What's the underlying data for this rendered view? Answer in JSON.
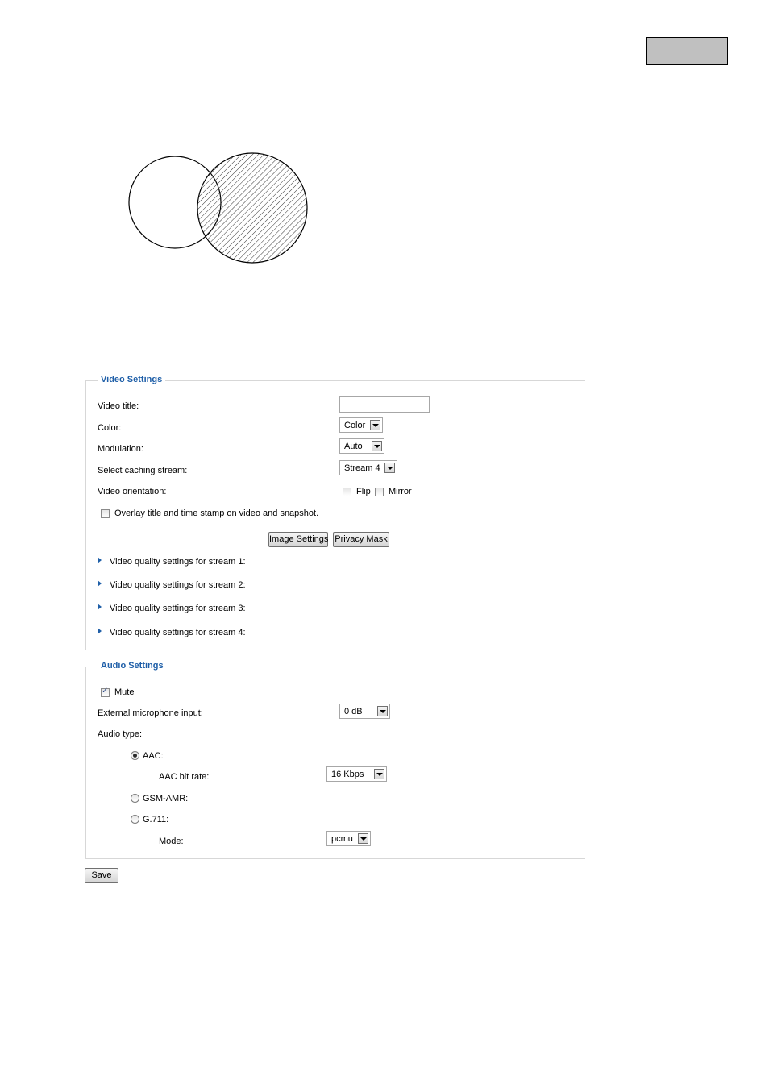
{
  "video": {
    "title": "Video Settings",
    "video_title_label": "Video title:",
    "video_title_value": "",
    "color_label": "Color:",
    "color_value": "Color",
    "modulation_label": "Modulation:",
    "modulation_value": "Auto",
    "caching_label": "Select caching stream:",
    "caching_value": "Stream 4",
    "orientation_label": "Video orientation:",
    "flip_label": "Flip",
    "mirror_label": "Mirror",
    "overlay_label": "Overlay title and time stamp on video and snapshot.",
    "image_settings_button": "Image Settings",
    "privacy_mask_button": "Privacy Mask",
    "streams": [
      "Video quality settings for stream 1:",
      "Video quality settings for stream 2:",
      "Video quality settings for stream 3:",
      "Video quality settings for stream 4:"
    ]
  },
  "audio": {
    "title": "Audio Settings",
    "mute_label": "Mute",
    "mic_label": "External microphone input:",
    "mic_value": "0 dB",
    "type_label": "Audio type:",
    "aac_label": "AAC:",
    "aac_bitrate_label": "AAC bit rate:",
    "aac_bitrate_value": "16 Kbps",
    "gsm_label": "GSM-AMR:",
    "g711_label": "G.711:",
    "mode_label": "Mode:",
    "mode_value": "pcmu"
  },
  "save_button": "Save"
}
